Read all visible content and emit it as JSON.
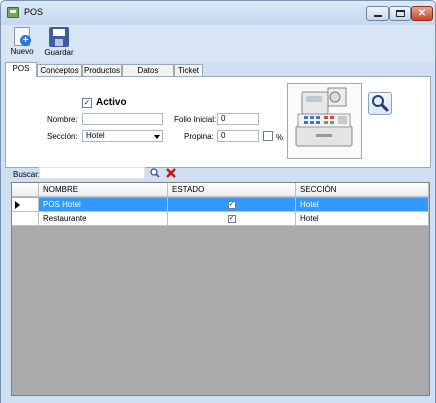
{
  "window": {
    "title": "POS"
  },
  "toolbar": {
    "nuevo_label": "Nuevo",
    "guardar_label": "Guardar"
  },
  "tabs": [
    "POS",
    "Conceptos",
    "Productos",
    "Datos Fiscales",
    "Ticket"
  ],
  "form": {
    "activo_label": "Activo",
    "activo_checked": "✓",
    "nombre_label": "Nombre:",
    "nombre_value": "",
    "seccion_label": "Sección:",
    "seccion_value": "Hotel",
    "folio_label": "Folio Inicial:",
    "folio_value": "0",
    "propina_label": "Propina:",
    "propina_value": "0",
    "percent": "%"
  },
  "search": {
    "label": "Buscar:",
    "value": ""
  },
  "grid": {
    "columns": [
      "NOMBRE",
      "ESTADO",
      "SECCIÓN"
    ],
    "rows": [
      {
        "nombre": "POS Hotel",
        "estado": "✓",
        "seccion": "Hotel",
        "selected": true
      },
      {
        "nombre": "Restaurante",
        "estado": "✓",
        "seccion": "Hotel",
        "selected": false
      }
    ]
  },
  "icons": {
    "app": "pos-app-icon",
    "nuevo": "new-document-icon",
    "guardar": "save-icon",
    "photo": "cash-register-image",
    "search": "magnifier-icon",
    "clear": "red-x-icon",
    "row_pointer": "row-pointer-icon"
  },
  "colors": {
    "selection": "#3399ff",
    "grid_background": "#ababab",
    "window_frame": "#cfe0f2",
    "clear_icon": "#d01010"
  }
}
